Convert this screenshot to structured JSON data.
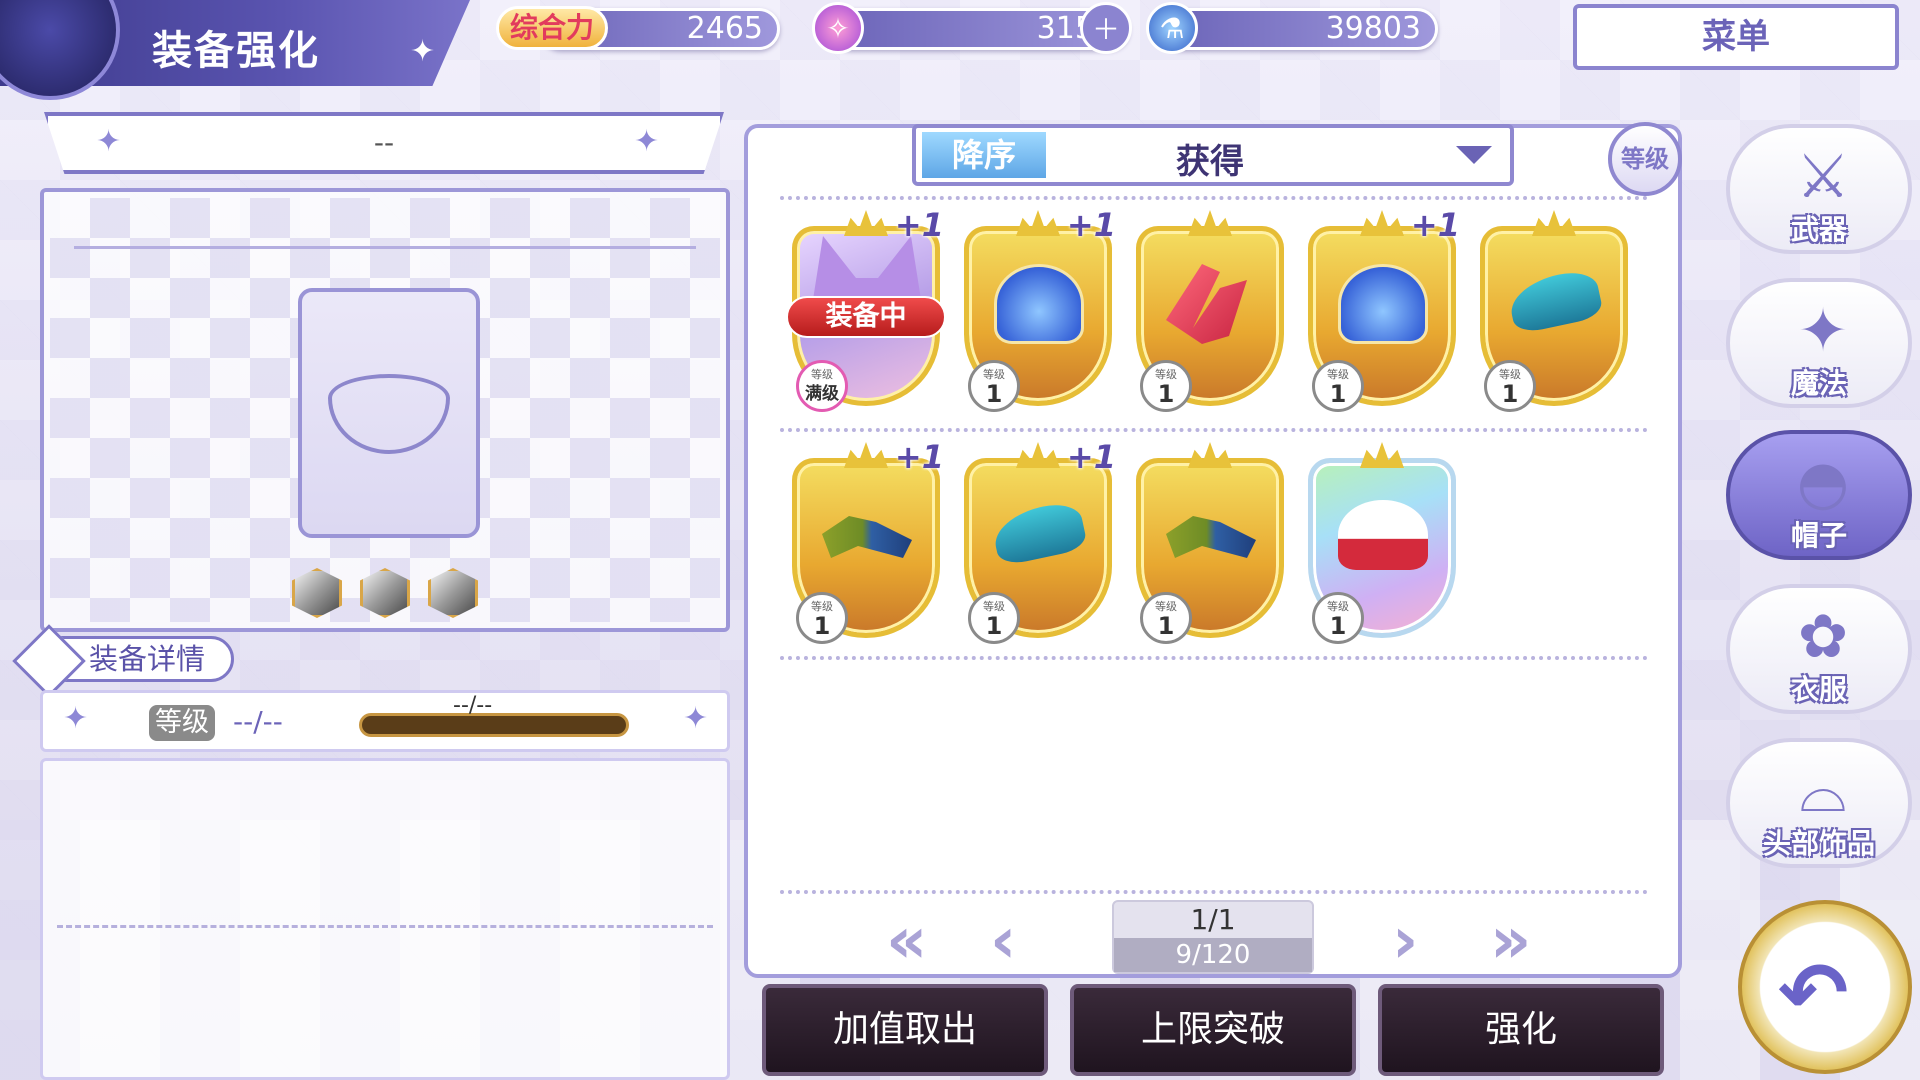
{
  "header": {
    "title": "装备强化",
    "power_label": "综合力",
    "power_value": "2465",
    "currency1_value": "3150",
    "currency2_value": "39803",
    "menu_label": "菜单"
  },
  "left_panel": {
    "item_name": "--",
    "detail_tab_label": "装备详情",
    "level_badge": "等级",
    "level_value": "--/--",
    "exp_text": "--/--"
  },
  "sort": {
    "order_label": "降序",
    "sort_by": "获得",
    "level_button": "等级"
  },
  "items": [
    {
      "plus": "+1",
      "level_label": "等级",
      "level": "满级",
      "equipped": "装备中",
      "frame": "purple",
      "art": "ears",
      "max": true
    },
    {
      "plus": "+1",
      "level_label": "等级",
      "level": "1",
      "frame": "gold",
      "art": "hat-blue"
    },
    {
      "plus": "",
      "level_label": "等级",
      "level": "1",
      "frame": "gold",
      "art": "horn"
    },
    {
      "plus": "+1",
      "level_label": "等级",
      "level": "1",
      "frame": "gold",
      "art": "hat-blue"
    },
    {
      "plus": "",
      "level_label": "等级",
      "level": "1",
      "frame": "gold",
      "art": "beret"
    },
    {
      "plus": "+1",
      "level_label": "等级",
      "level": "1",
      "frame": "gold",
      "art": "cap"
    },
    {
      "plus": "+1",
      "level_label": "等级",
      "level": "1",
      "frame": "gold",
      "art": "beret"
    },
    {
      "plus": "",
      "level_label": "等级",
      "level": "1",
      "frame": "gold",
      "art": "cap"
    },
    {
      "plus": "",
      "level_label": "等级",
      "level": "1",
      "frame": "rainbow",
      "art": "nurse"
    }
  ],
  "pagination": {
    "page": "1/1",
    "count": "9/120"
  },
  "actions": {
    "extract": "加值取出",
    "limit_break": "上限突破",
    "enhance": "强化"
  },
  "categories": [
    {
      "label": "武器",
      "icon": "⚔"
    },
    {
      "label": "魔法",
      "icon": "✦"
    },
    {
      "label": "帽子",
      "icon": "◓"
    },
    {
      "label": "衣服",
      "icon": "✿"
    },
    {
      "label": "头部饰品",
      "icon": "⌓"
    }
  ],
  "active_category": 2
}
